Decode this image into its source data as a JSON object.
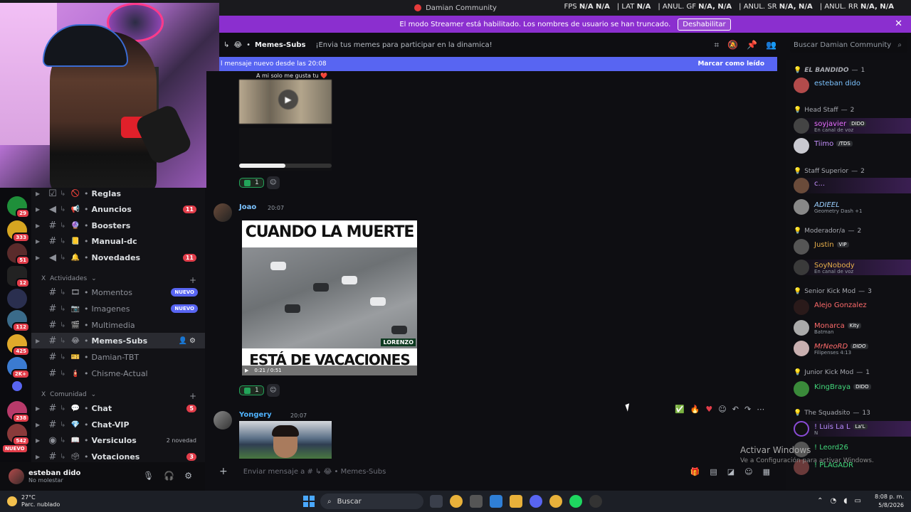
{
  "titlebar": {
    "title": "Damian Community"
  },
  "perf": [
    {
      "label": "FPS",
      "value": "N/A  N/A"
    },
    {
      "label": "LAT",
      "value": "N/A"
    },
    {
      "label": "ANUL. GF",
      "value": "N/A, N/A"
    },
    {
      "label": "ANUL. SR",
      "value": "N/A, N/A"
    },
    {
      "label": "ANUL. RR",
      "value": "N/A, N/A"
    }
  ],
  "streamer": {
    "message": "El modo Streamer está habilitado. Los nombres de usuario se han truncado.",
    "button": "Deshabilitar"
  },
  "channel_header": {
    "name": "Memes-Subs",
    "topic": "¡Envia tus memes para participar en la dinamica!"
  },
  "search": {
    "placeholder": "Buscar Damian Community"
  },
  "newbar": {
    "text": "l mensaje nuevo desde las 20:08",
    "mark": "Marcar como leído"
  },
  "servers": [
    {
      "badge": "29"
    },
    {
      "badge": "333"
    },
    {
      "badge": "51"
    },
    {
      "badge": "12"
    },
    {
      "badge": ""
    },
    {
      "badge": "112"
    },
    {
      "badge": "425"
    },
    {
      "badge": "2K+"
    },
    {
      "badge": ""
    },
    {
      "badge": "238"
    },
    {
      "badge": "542"
    }
  ],
  "rail_nuevo": "NUEVO",
  "channels": [
    {
      "name": "Reglas",
      "emoji": "🚫",
      "icon": "☑",
      "count": ""
    },
    {
      "name": "Anuncios",
      "emoji": "📢",
      "icon": "📢",
      "count": "11"
    },
    {
      "name": "Boosters",
      "emoji": "🔮",
      "icon": "#",
      "count": ""
    },
    {
      "name": "Manual-dc",
      "emoji": "📒",
      "icon": "#",
      "count": ""
    },
    {
      "name": "Novedades",
      "emoji": "🔔",
      "icon": "📢",
      "count": "11"
    }
  ],
  "cat_actividades": "Actividades",
  "channels2": [
    {
      "name": "Momentos",
      "emoji": "🎞",
      "badge": "NUEVO"
    },
    {
      "name": "Imagenes",
      "emoji": "📷",
      "badge": "NUEVO"
    },
    {
      "name": "Multimedia",
      "emoji": "🎬",
      "badge": ""
    },
    {
      "name": "Memes-Subs",
      "emoji": "😂",
      "badge": ""
    },
    {
      "name": "Damian-TBT",
      "emoji": "🎫",
      "badge": ""
    },
    {
      "name": "Chisme-Actual",
      "emoji": "🧯",
      "badge": ""
    }
  ],
  "cat_comunidad": "Comunidad",
  "channels3": [
    {
      "name": "Chat",
      "emoji": "💬",
      "count": "5",
      "txt": ""
    },
    {
      "name": "Chat-VIP",
      "emoji": "💎",
      "count": "",
      "txt": ""
    },
    {
      "name": "Versiculos",
      "emoji": "📖",
      "count": "",
      "txt": "2 novedad"
    },
    {
      "name": "Votaciones",
      "emoji": "🗳",
      "count": "3",
      "txt": ""
    }
  ],
  "user": {
    "name": "esteban dido",
    "status": "No molestar"
  },
  "messages": {
    "caption": "A mi solo me gusta tu ❤️",
    "react1": "1",
    "author2": "Joao",
    "time2": "20:07",
    "meme_top": "CUANDO LA MUERTE",
    "meme_bottom": "ESTÁ DE VACACIONES",
    "meme_tag": "LORENZO",
    "video_time": "0:21 / 0:51",
    "react2": "1",
    "author3": "Yongery",
    "time3": "20:07"
  },
  "composer": {
    "placeholder": "Enviar mensaje a #",
    "channel": "Memes-Subs"
  },
  "members": {
    "groups": [
      {
        "title": "EL BANDIDO",
        "count": "1"
      },
      {
        "title": "Head Staff",
        "count": "2"
      },
      {
        "title": "Staff Superior",
        "count": "2"
      },
      {
        "title": "Moderador/a",
        "count": "2"
      },
      {
        "title": "Senior Kick Mod",
        "count": "3"
      },
      {
        "title": "Junior Kick Mod",
        "count": "1"
      },
      {
        "title": "The Squadsito",
        "count": "13"
      }
    ],
    "list": [
      {
        "name": "esteban dido",
        "sub": "",
        "tag": "",
        "color": "#7cc3ff"
      },
      {
        "name": "soyjavier",
        "sub": "En canal de voz",
        "tag": "DIDO",
        "color": "#e86fff"
      },
      {
        "name": "Tiimo",
        "sub": "",
        "tag": "/TDS",
        "color": "#c792ff"
      },
      {
        "name": "c...",
        "sub": "",
        "tag": "",
        "color": "#c792ff"
      },
      {
        "name": "ADIEEL",
        "sub": "Geometry Dash +1",
        "tag": "",
        "color": "#9bd0ff"
      },
      {
        "name": "Justin",
        "sub": "",
        "tag": "VIP",
        "color": "#e9b04b"
      },
      {
        "name": "SoyNobody",
        "sub": "En canal de voz",
        "tag": "",
        "color": "#e9b04b"
      },
      {
        "name": "Alejo Gonzalez",
        "sub": "",
        "tag": "",
        "color": "#ff6b6b"
      },
      {
        "name": "Monarca",
        "sub": "Batman",
        "tag": "Kity",
        "color": "#ff6b6b"
      },
      {
        "name": "MrNeoRD",
        "sub": "Filipenses 4:13",
        "tag": "DIDO",
        "color": "#ff6b6b"
      },
      {
        "name": "KingBraya",
        "sub": "",
        "tag": "DIDO",
        "color": "#42d97b"
      },
      {
        "name": "! Luis La L",
        "sub": "N",
        "tag": "La'L",
        "color": "#b98cff"
      },
      {
        "name": "! Leord26",
        "sub": "",
        "tag": "",
        "color": "#b98cff"
      },
      {
        "name": "! PLAGADR",
        "sub": "",
        "tag": "",
        "color": "#b98cff"
      }
    ]
  },
  "watermark": {
    "title": "Activar Windows",
    "sub": "Ve a Configuración para activar Windows."
  },
  "taskbar": {
    "temp": "27°C",
    "weather": "Parc. nublado",
    "search": "Buscar",
    "time": "8:08 p. m.",
    "date": "5/8/2026"
  }
}
